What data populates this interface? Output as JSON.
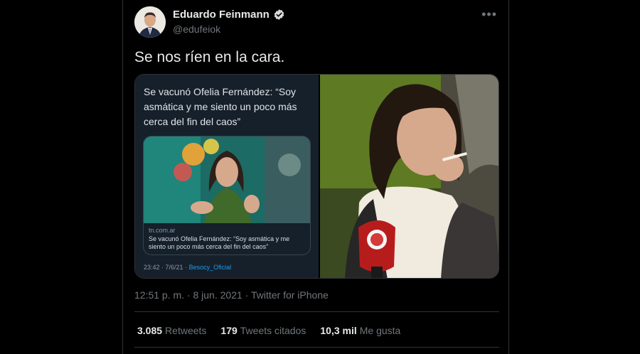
{
  "author": {
    "name": "Eduardo Feinmann",
    "handle": "@edufeiok",
    "verified": true,
    "avatar_icon": "avatar-photo"
  },
  "tweet_text": "Se nos ríen en la cara.",
  "embedded_tweet": {
    "text": "Se vacunó Ofelia Fernández: “Soy asmática y me siento un poco más cerca del fin del caos”",
    "card_domain": "tn.com.ar",
    "card_title": "Se vacunó Ofelia Fernández: “Soy asmática y me siento un poco más cerca del fin del caos”",
    "time": "23:42 · 7/6/21 ·",
    "source_account": "Besocy_Oficial"
  },
  "timestamp": "12:51 p. m. · 8 jun. 2021 · Twitter for iPhone",
  "stats": {
    "retweets_count": "3.085",
    "retweets_label": "Retweets",
    "quotes_count": "179",
    "quotes_label": "Tweets citados",
    "likes_count": "10,3 mil",
    "likes_label": "Me gusta"
  },
  "colors": {
    "background": "#000000",
    "verified": "#d9d9d9",
    "link": "#1d9bf0"
  }
}
